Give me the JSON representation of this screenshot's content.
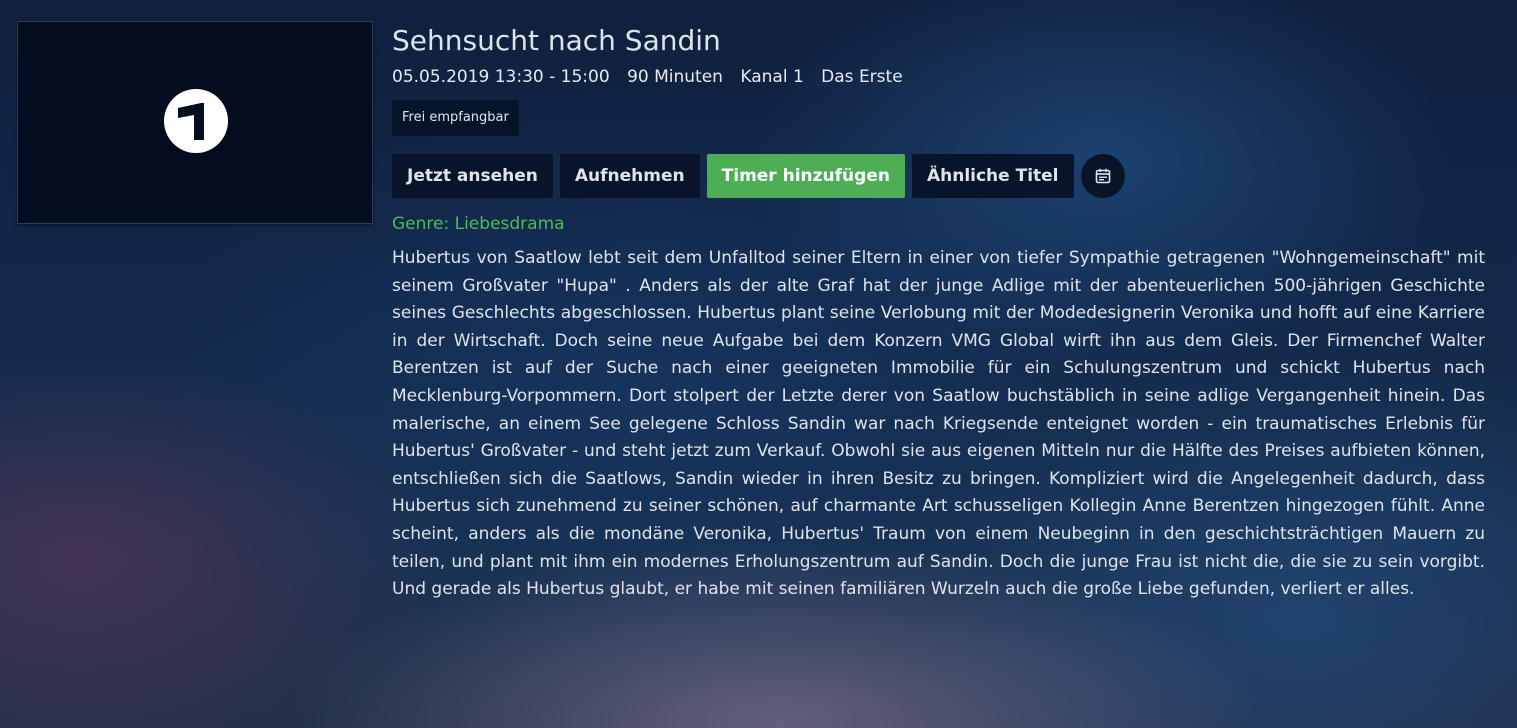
{
  "channel_logo": {
    "icon": "das-erste-logo-icon",
    "glyph": "1"
  },
  "program": {
    "title": "Sehnsucht nach Sandin",
    "date_time": "05.05.2019 13:30 - 15:00",
    "duration": "90 Minuten",
    "channel_number": "Kanal 1",
    "channel_name": "Das Erste",
    "badge": "Frei empfangbar",
    "genre": "Genre: Liebesdrama",
    "description": "Hubertus von Saatlow lebt seit dem Unfalltod seiner Eltern in einer von tiefer Sympathie getragenen \"Wohngemeinschaft\" mit seinem Großvater \"Hupa\" . Anders als der alte Graf hat der junge Adlige mit der abenteuerlichen 500-jährigen Geschichte seines Geschlechts abgeschlossen. Hubertus plant seine Verlobung mit der Modedesignerin Veronika und hofft auf eine Karriere in der Wirtschaft. Doch seine neue Aufgabe bei dem Konzern VMG Global wirft ihn aus dem Gleis. Der Firmenchef Walter Berentzen ist auf der Suche nach einer geeigneten Immobilie für ein Schulungszentrum und schickt Hubertus nach Mecklenburg-Vorpommern. Dort stolpert der Letzte derer von Saatlow buchstäblich in seine adlige Vergangenheit hinein. Das malerische, an einem See gelegene Schloss Sandin war nach Kriegsende enteignet worden - ein traumatisches Erlebnis für Hubertus' Großvater - und steht jetzt zum Verkauf. Obwohl sie aus eigenen Mitteln nur die Hälfte des Preises aufbieten können, entschließen sich die Saatlows, Sandin wieder in ihren Besitz zu bringen. Kompliziert wird die Angelegenheit dadurch, dass Hubertus sich zunehmend zu seiner schönen, auf charmante Art schusseligen Kollegin Anne Berentzen hingezogen fühlt. Anne scheint, anders als die mondäne Veronika, Hubertus' Traum von einem Neubeginn in den geschichtsträchtigen Mauern zu teilen, und plant mit ihm ein modernes Erholungszentrum auf Sandin. Doch die junge Frau ist nicht die, die sie zu sein vorgibt. Und gerade als Hubertus glaubt, er habe mit seinen familiären Wurzeln auch die große Liebe gefunden, verliert er alles."
  },
  "actions": {
    "watch_now": "Jetzt ansehen",
    "record": "Aufnehmen",
    "add_timer": "Timer hinzufügen",
    "similar_titles": "Ähnliche Titel",
    "calendar_icon": "calendar-icon"
  },
  "colors": {
    "primary_button": "#4dae55",
    "genre_text": "#4fba59",
    "button_background": "#07142a"
  }
}
